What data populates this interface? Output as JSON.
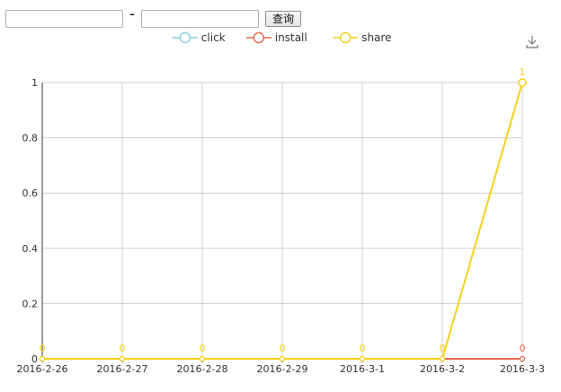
{
  "controls": {
    "start_value": "",
    "end_value": "",
    "separator": "-",
    "query_label": "查询"
  },
  "toolbox": {
    "download_icon": "download-icon"
  },
  "chart_data": {
    "type": "line",
    "title": "",
    "xlabel": "",
    "ylabel": "",
    "categories": [
      "2016-2-26",
      "2016-2-27",
      "2016-2-28",
      "2016-2-29",
      "2016-3-1",
      "2016-3-2",
      "2016-3-3"
    ],
    "ylim": [
      0,
      1
    ],
    "yticks": [
      "0",
      "0.2",
      "0.4",
      "0.6",
      "0.8",
      "1"
    ],
    "grid": true,
    "legend_position": "top-center",
    "series": [
      {
        "name": "click",
        "color": "#8ecfe2",
        "values": [
          0,
          0,
          0,
          0,
          0,
          0,
          0
        ],
        "labels": [
          "",
          "",
          "",
          "",
          "",
          "",
          ""
        ]
      },
      {
        "name": "install",
        "color": "#e86b4e",
        "values": [
          0,
          0,
          0,
          0,
          0,
          0,
          0
        ],
        "labels": [
          "",
          "",
          "",
          "",
          "",
          "",
          "0"
        ]
      },
      {
        "name": "share",
        "color": "#f4d21d",
        "values": [
          0,
          0,
          0,
          0,
          0,
          0,
          1
        ],
        "labels": [
          "0",
          "0",
          "0",
          "0",
          "0",
          "0",
          "1"
        ]
      }
    ]
  }
}
